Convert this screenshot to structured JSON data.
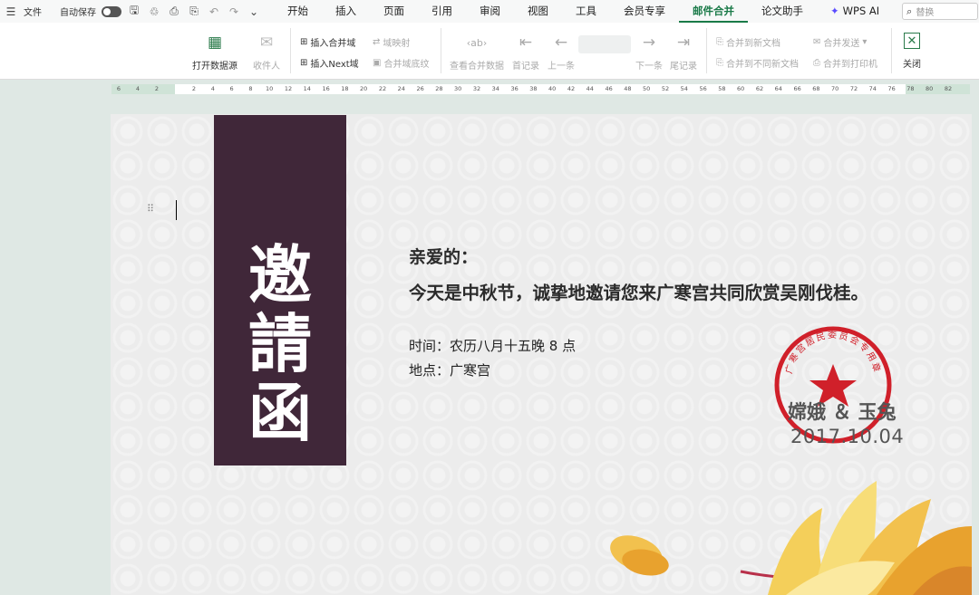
{
  "menubar": {
    "file": "文件",
    "autosave": "自动保存",
    "tabs": [
      "开始",
      "插入",
      "页面",
      "引用",
      "审阅",
      "视图",
      "工具",
      "会员专享",
      "邮件合并",
      "论文助手"
    ],
    "active_tab": "邮件合并",
    "wps_ai": "WPS AI",
    "search_placeholder": "替换"
  },
  "ribbon": {
    "open_data_source": "打开数据源",
    "recipients": "收件人",
    "insert_merge_field": "插入合并域",
    "insert_next_field": "插入Next域",
    "field_mapping": "域映射",
    "merge_field_shading": "合并域底纹",
    "view_merge_data": "查看合并数据",
    "first_record": "首记录",
    "prev": "上一条",
    "next": "下一条",
    "last_record": "尾记录",
    "merge_to_new_doc": "合并到新文档",
    "merge_to_diff_docs": "合并到不同新文档",
    "merge_send": "合并发送",
    "merge_to_printer": "合并到打印机",
    "close": "关闭"
  },
  "ruler": {
    "left_ticks": [
      "6",
      "4",
      "2"
    ],
    "ticks": [
      "2",
      "4",
      "6",
      "8",
      "10",
      "12",
      "14",
      "16",
      "18",
      "20",
      "22",
      "24",
      "26",
      "28",
      "30",
      "32",
      "34",
      "36",
      "38",
      "40",
      "42",
      "44",
      "46",
      "48",
      "50",
      "52",
      "54",
      "56",
      "58",
      "60",
      "62",
      "64",
      "66",
      "68",
      "70",
      "72",
      "74",
      "76",
      "78",
      "80",
      "82"
    ]
  },
  "document": {
    "vertical_title": [
      "邀",
      "請",
      "函"
    ],
    "greeting": "亲爱的：",
    "main_text": "今天是中秋节，诚挚地邀请您来广寒宫共同欣赏吴刚伐桂。",
    "time": "时间：农历八月十五晚 8 点",
    "place": "地点：广寒宫",
    "names": "嫦娥 ＆ 玉兔",
    "date": "2017.10.04",
    "seal_text": "广寒宫居民委员会专用章"
  },
  "colors": {
    "accent": "#1a7a48",
    "title_panel": "#402739",
    "seal": "#d0202a"
  }
}
